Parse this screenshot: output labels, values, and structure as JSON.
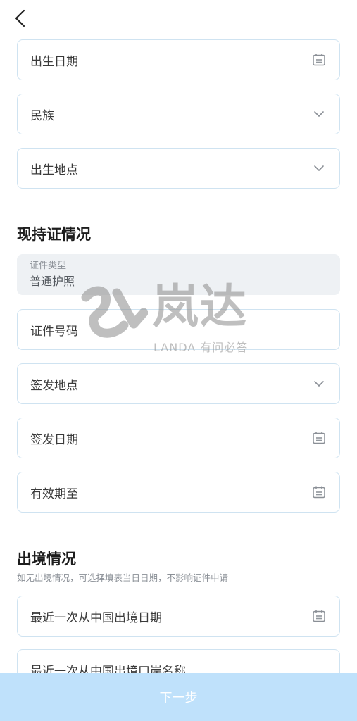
{
  "header": {
    "back_icon": "chevron-left-icon"
  },
  "fields_top": {
    "birth_date": "出生日期",
    "ethnicity": "民族",
    "birth_place": "出生地点"
  },
  "current_cert": {
    "title": "现持证情况",
    "cert_type_label": "证件类型",
    "cert_type_value": "普通护照",
    "cert_number": "证件号码",
    "issue_place": "签发地点",
    "issue_date": "签发日期",
    "valid_until": "有效期至"
  },
  "exit": {
    "title": "出境情况",
    "note": "如无出境情况，可选择填表当日日期，不影响证件申请",
    "last_exit_date": "最近一次从中国出境日期",
    "last_exit_port": "最近一次从中国出境口岸名称"
  },
  "watermark": {
    "brand": "岚达",
    "sub": "LANDA  有问必答"
  },
  "footer": {
    "next_label": "下一步"
  },
  "colors": {
    "accent": "#bfe1fb",
    "border": "#cfe3f1"
  }
}
